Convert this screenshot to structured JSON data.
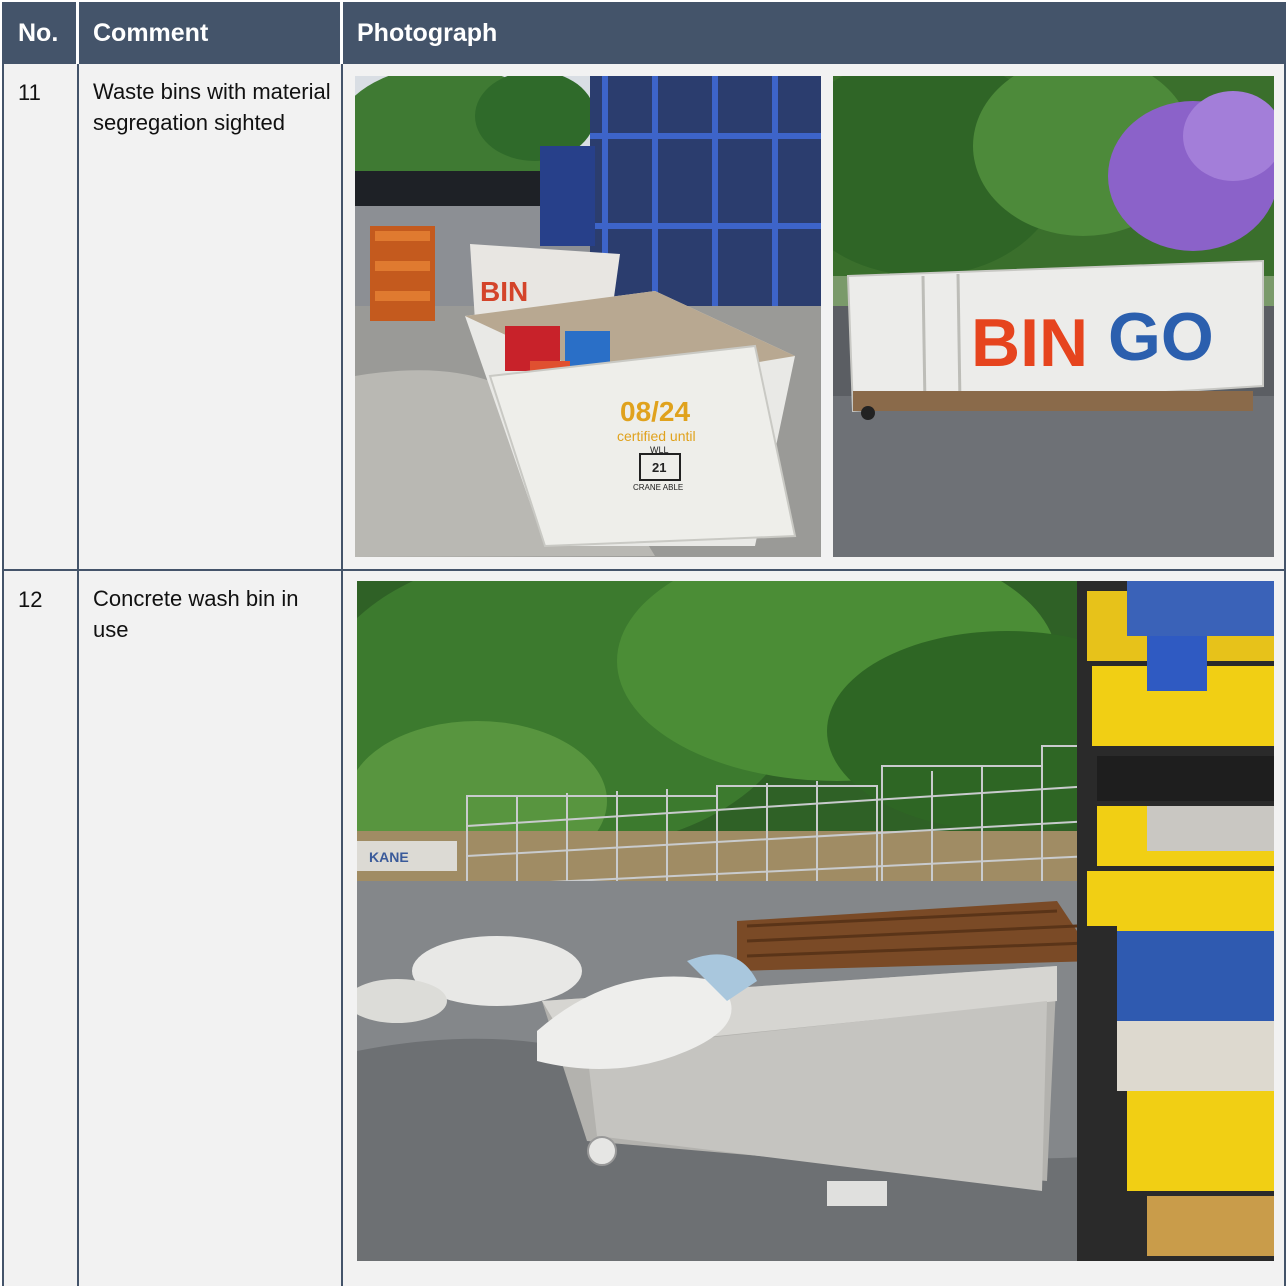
{
  "headers": {
    "no": "No.",
    "comment": "Comment",
    "photograph": "Photograph"
  },
  "rows": [
    {
      "no": "11",
      "comment": "Waste bins with material segregation sighted",
      "photos": [
        {
          "subject": "skip bin with mixed waste",
          "stencil_date": "08/24",
          "stencil_text": "certified until",
          "wll_label": "WLL",
          "wll_value": "21",
          "crane_label": "CRANE ABLE",
          "back_bin_text": "BIN"
        },
        {
          "subject": "large roll-on waste bin",
          "brand_text_1": "BIN",
          "brand_text_2": "GO"
        }
      ]
    },
    {
      "no": "12",
      "comment": "Concrete wash bin in use",
      "photos": [
        {
          "subject": "concrete wash bin beside pallets and fencing",
          "sign_text": "KANE"
        }
      ]
    }
  ]
}
